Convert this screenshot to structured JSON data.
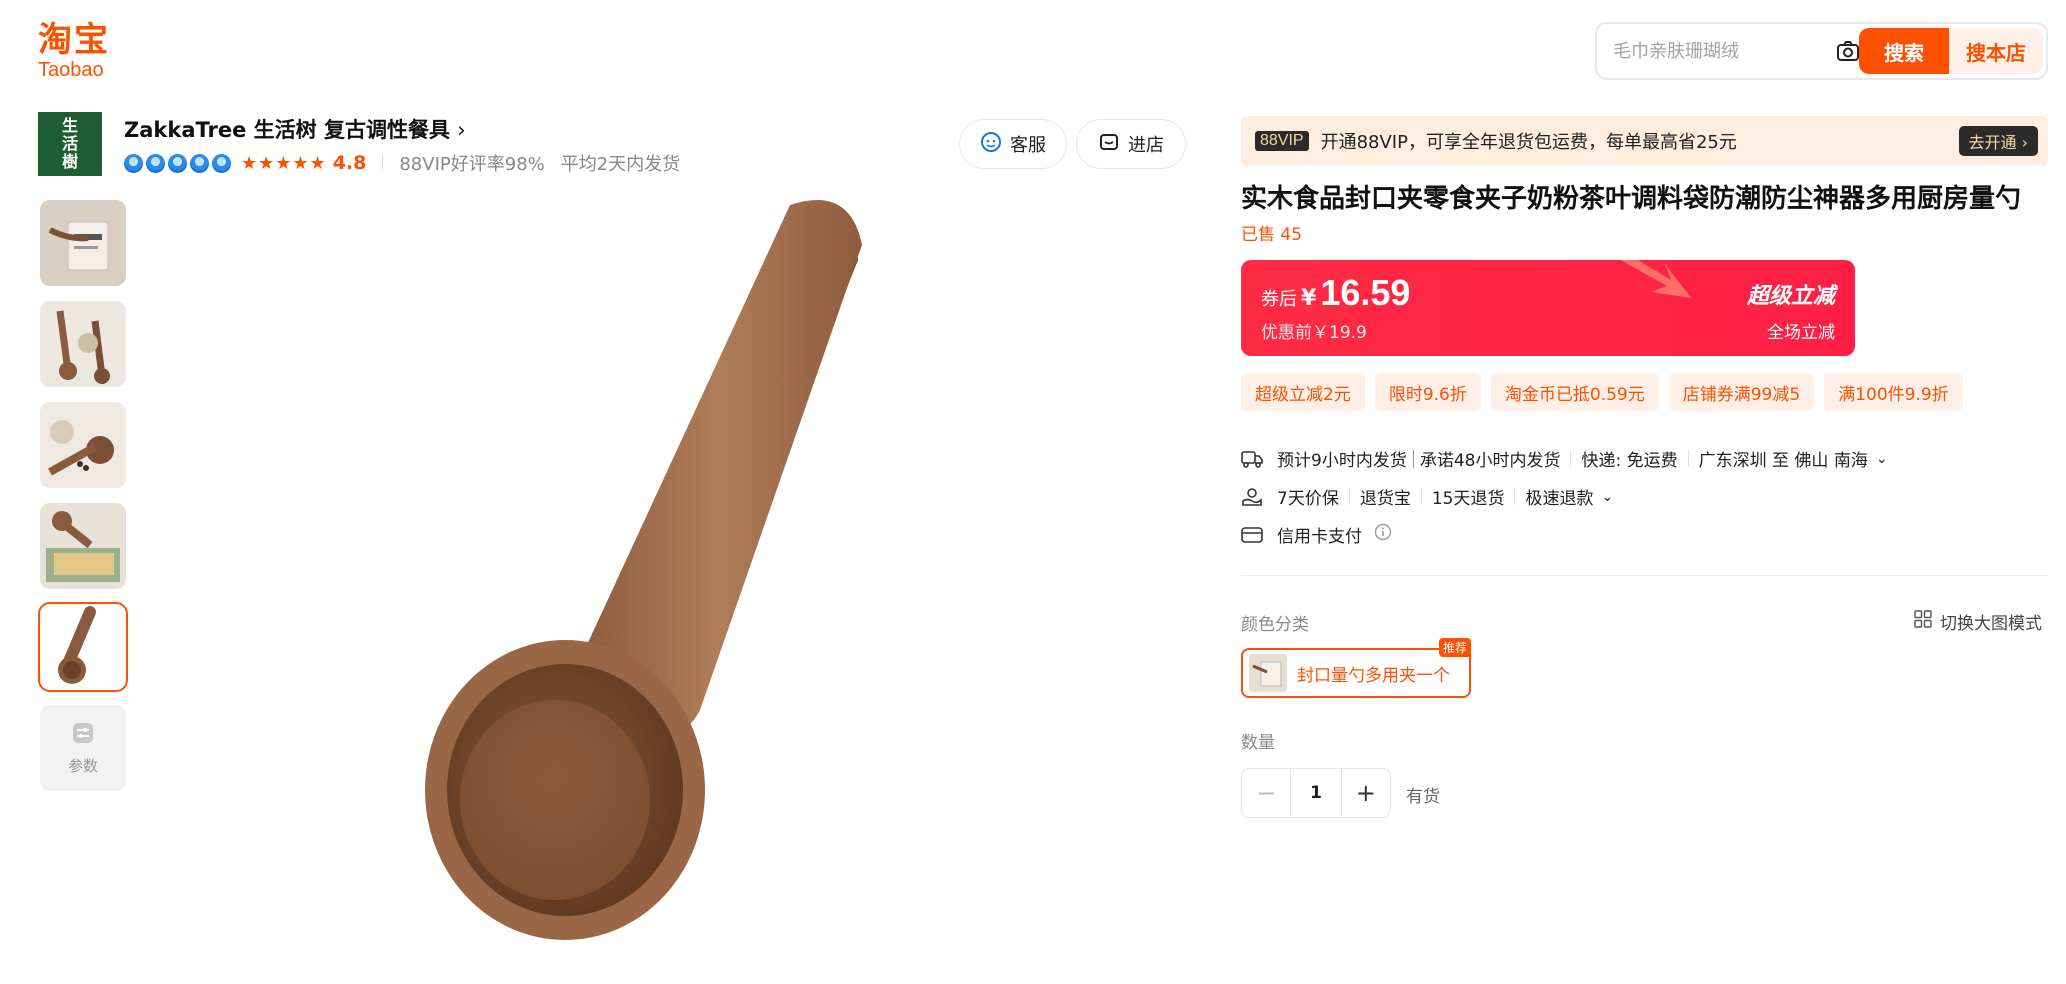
{
  "header": {
    "logo_cn": "淘宝",
    "logo_en": "Taobao",
    "search_placeholder": "毛巾亲肤珊瑚绒",
    "search_label": "搜索",
    "shop_search_label": "搜本店"
  },
  "store": {
    "logo_chars": [
      "生",
      "活",
      "樹"
    ],
    "name": "ZakkaTree 生活树 复古调性餐具",
    "stars": "★★★★★",
    "rating": "4.8",
    "good_rate": "88VIP好评率98%",
    "ship_time": "平均2天内发货",
    "service_label": "客服",
    "enter_label": "进店"
  },
  "gallery": {
    "params_label": "参数"
  },
  "vip": {
    "badge": "88VIP",
    "text": "开通88VIP，可享全年退货包运费，每单最高省25元",
    "button": "去开通 ›"
  },
  "product": {
    "title": "实木食品封口夹零食夹子奶粉茶叶调料袋防潮防尘神器多用厨房量勺",
    "sold": "已售 45"
  },
  "price": {
    "label": "券后",
    "currency": "¥",
    "value": "16.59",
    "original": "优惠前￥19.9",
    "super_label": "超级立减",
    "all_label": "全场立减"
  },
  "coupons": [
    "超级立减2元",
    "限时9.6折",
    "淘金币已抵0.59元",
    "店铺券满99减5",
    "满100件9.9折"
  ],
  "shipping": {
    "estimate": "预计9小时内发货",
    "promise": "承诺48小时内发货",
    "express": "快递: 免运费",
    "route": "广东深圳 至 佛山 南海"
  },
  "guarantees": [
    "7天价保",
    "退货宝",
    "15天退货",
    "极速退款"
  ],
  "payment": "信用卡支付",
  "options": {
    "color_label": "颜色分类",
    "switch_view": "切换大图模式",
    "sku_name": "封口量勺多用夹一个",
    "sku_tag": "推荐",
    "qty_label": "数量",
    "qty_value": "1",
    "stock": "有货"
  }
}
